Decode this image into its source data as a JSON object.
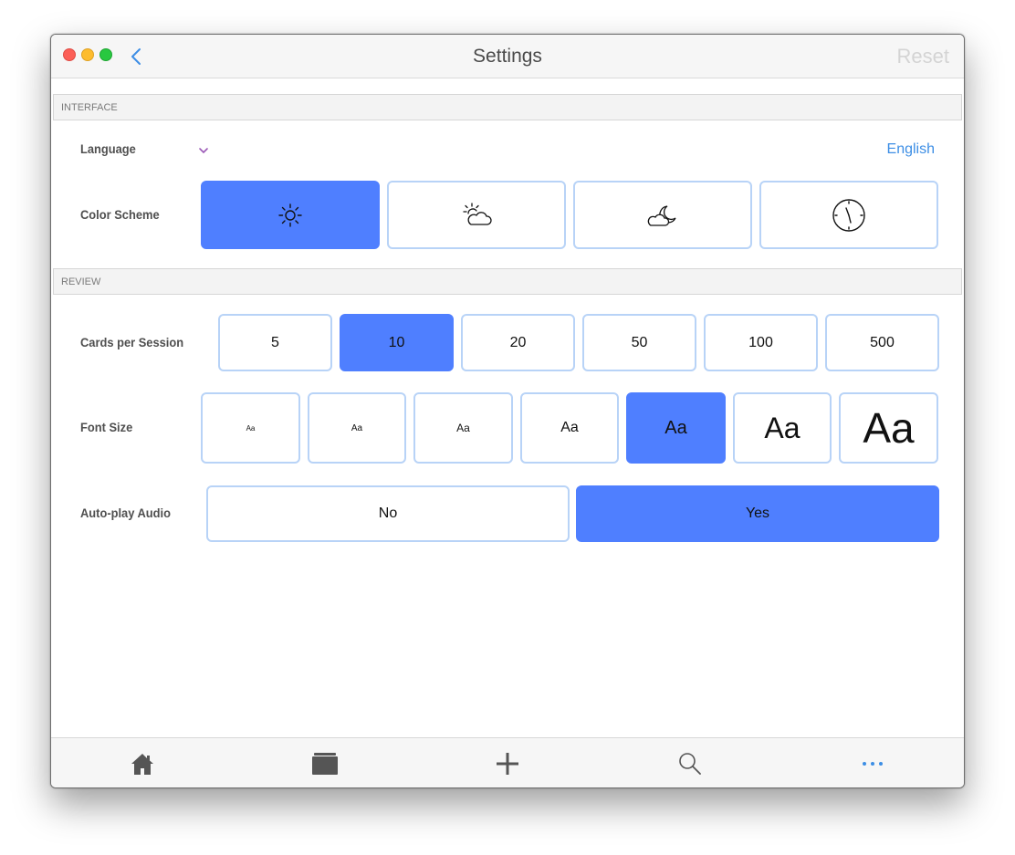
{
  "window": {
    "title": "Settings",
    "reset_label": "Reset"
  },
  "sections": {
    "interface": "INTERFACE",
    "review": "REVIEW"
  },
  "language": {
    "label": "Language",
    "value": "English"
  },
  "color_scheme": {
    "label": "Color Scheme",
    "options": [
      {
        "icon": "sun-icon",
        "selected": true
      },
      {
        "icon": "partly-cloudy-icon",
        "selected": false
      },
      {
        "icon": "moon-cloud-icon",
        "selected": false
      },
      {
        "icon": "clock-icon",
        "selected": false
      }
    ]
  },
  "cards_per_session": {
    "label": "Cards per Session",
    "options": [
      "5",
      "10",
      "20",
      "50",
      "100",
      "500"
    ],
    "selected": "10"
  },
  "font_size": {
    "label": "Font Size",
    "sample": "Aa",
    "option_count": 7,
    "selected_index": 4
  },
  "auto_play_audio": {
    "label": "Auto-play Audio",
    "options": [
      "No",
      "Yes"
    ],
    "selected": "Yes"
  },
  "tabbar": {
    "items": [
      {
        "icon": "home-icon",
        "active": false
      },
      {
        "icon": "card-deck-icon",
        "active": false
      },
      {
        "icon": "add-icon",
        "active": false
      },
      {
        "icon": "search-icon",
        "active": false
      },
      {
        "icon": "more-icon",
        "active": true
      }
    ]
  },
  "colors": {
    "accent": "#4f7fff",
    "link": "#3d8ee5",
    "option_border": "#b8d3f7",
    "chevron": "#9b59b6"
  }
}
